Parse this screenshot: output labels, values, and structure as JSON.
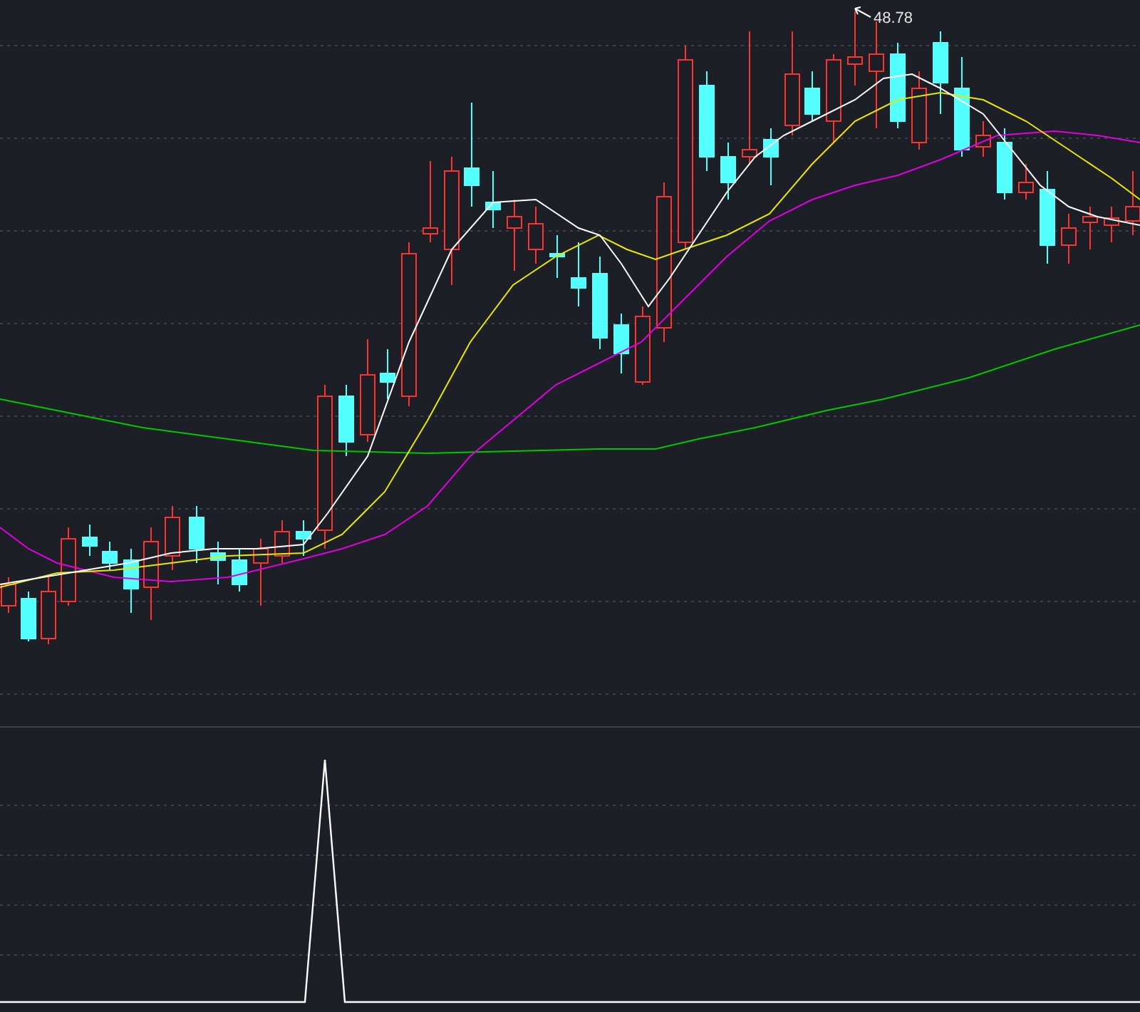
{
  "price_chart": {
    "high_label": "48.78"
  }
}
